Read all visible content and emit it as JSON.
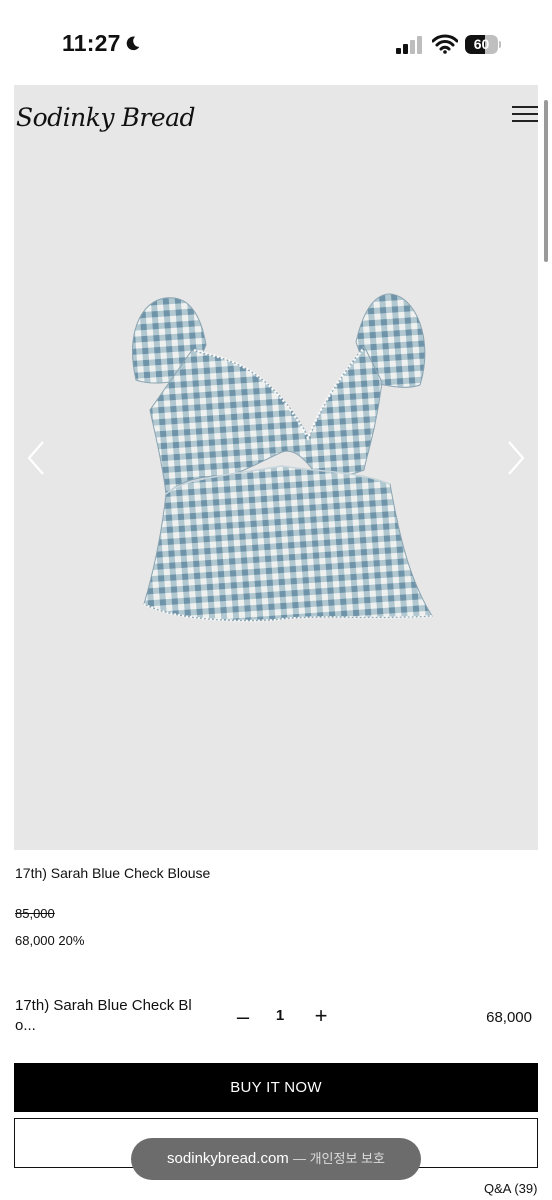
{
  "status_bar": {
    "time": "11:27",
    "battery": "60",
    "battery_level": 0.6
  },
  "header": {
    "logo": "Sodinky Bread"
  },
  "product": {
    "title": "17th) Sarah Blue Check Blouse",
    "price_original": "85,000",
    "price_sale": "68,000 20%"
  },
  "option": {
    "name": "17th) Sarah Blue Check Bl o...",
    "quantity": "1",
    "price": "68,000"
  },
  "actions": {
    "buy_now": "BUY IT NOW"
  },
  "browser": {
    "domain": "sodinkybread.com",
    "privacy": "— 개인정보 보호"
  },
  "tabs": {
    "qa": "Q&A (39)"
  },
  "colors": {
    "gallery_bg": "#e7e7e7",
    "gingham_blue": "#7fa3b8",
    "button_black": "#000000"
  },
  "icons": [
    "moon-icon",
    "signal-icon",
    "wifi-icon",
    "battery-icon",
    "menu-icon",
    "chevron-left-icon",
    "chevron-right-icon",
    "minus-icon",
    "plus-icon"
  ]
}
